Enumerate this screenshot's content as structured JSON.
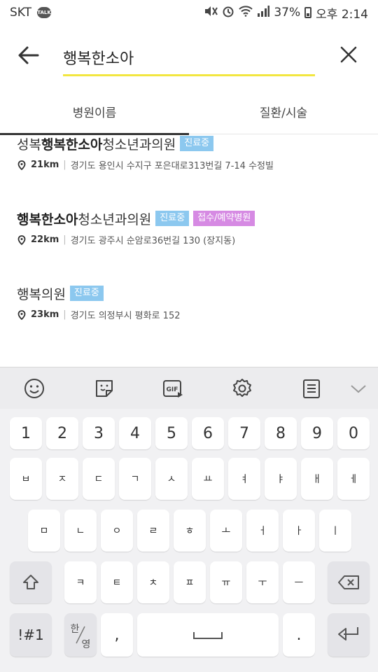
{
  "status_bar": {
    "carrier": "SKT",
    "talk_badge": "TALK",
    "battery": "37%",
    "time": "오후 2:14"
  },
  "search": {
    "query": "행복한소아",
    "back_icon": "arrow-left-icon",
    "clear_icon": "close-icon"
  },
  "tabs": [
    {
      "label": "병원이름",
      "active": true
    },
    {
      "label": "질환/시술",
      "active": false
    }
  ],
  "results": [
    {
      "name_prefix": "성복",
      "name_highlight": "행복한소아",
      "name_suffix": "청소년과의원",
      "badges": [
        {
          "label": "진료중",
          "color": "#8cc8ef"
        }
      ],
      "distance": "21km",
      "address": "경기도 용인시 수지구 포은대로313번길 7-14 수정빌"
    },
    {
      "name_prefix": "",
      "name_highlight": "행복한소아",
      "name_suffix": "청소년과의원",
      "badges": [
        {
          "label": "진료중",
          "color": "#8cc8ef"
        },
        {
          "label": "접수/예약병원",
          "color": "#d68ae3"
        }
      ],
      "distance": "22km",
      "address": "경기도 광주시 순암로36번길 130 (장지동)"
    },
    {
      "name_prefix": "",
      "name_highlight": "",
      "name_suffix": "행복의원",
      "badges": [
        {
          "label": "진료중",
          "color": "#8cc8ef"
        }
      ],
      "distance": "23km",
      "address": "경기도 의정부시 평화로 152"
    }
  ],
  "keyboard": {
    "row_numbers": [
      "1",
      "2",
      "3",
      "4",
      "5",
      "6",
      "7",
      "8",
      "9",
      "0"
    ],
    "row_1": [
      "ㅂ",
      "ㅈ",
      "ㄷ",
      "ㄱ",
      "ㅅ",
      "ㅛ",
      "ㅕ",
      "ㅑ",
      "ㅐ",
      "ㅔ"
    ],
    "row_2": [
      "ㅁ",
      "ㄴ",
      "ㅇ",
      "ㄹ",
      "ㅎ",
      "ㅗ",
      "ㅓ",
      "ㅏ",
      "ㅣ"
    ],
    "row_3": [
      "ㅋ",
      "ㅌ",
      "ㅊ",
      "ㅍ",
      "ㅠ",
      "ㅜ",
      "ㅡ"
    ],
    "symbols_key": "!#1",
    "lang_key_top": "한",
    "lang_key_bottom": "영",
    "comma_key": ",",
    "period_key": "."
  }
}
